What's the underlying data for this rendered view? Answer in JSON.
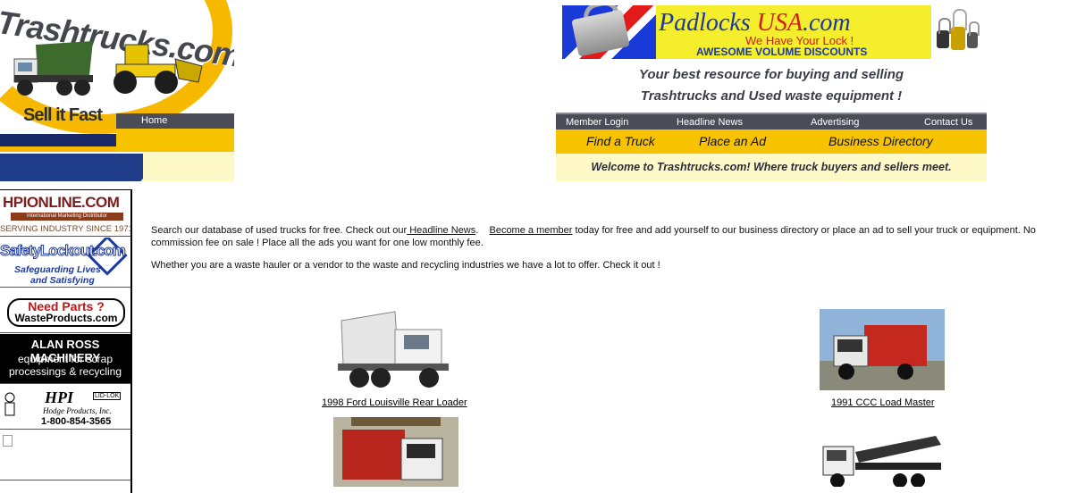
{
  "logo": {
    "title": "Trashtrucks.com",
    "slogan": "Sell it Fast",
    "home_label": "Home"
  },
  "banner": {
    "brand_main": "Padlocks ",
    "brand_accent": "USA",
    "brand_tail": ".com",
    "tagline": "We Have Your Lock !",
    "discount": "AWESOME VOLUME DISCOUNTS"
  },
  "header": {
    "tagline1": "Your best resource for buying and selling",
    "tagline2": "Trashtrucks and Used waste equipment !"
  },
  "nav": {
    "top": [
      "Member Login",
      "Headline News",
      "Advertising",
      "Contact Us"
    ],
    "main": [
      "Find a Truck",
      "Place an Ad",
      "Business Directory"
    ],
    "welcome": "Welcome to Trashtrucks.com! Where truck buyers and sellers meet."
  },
  "sidebar": {
    "ad1": {
      "title": "HPIONLINE.COM",
      "bar": "International Marketing Distributor",
      "sub": "SERVING INDUSTRY SINCE 1971"
    },
    "ad2": {
      "title": "SafetyLockout.com",
      "line1": "Safeguarding Lives",
      "line2": "and Satisfying Regulations"
    },
    "ad3": {
      "line1": "Need Parts ?",
      "line2": "WasteProducts.com"
    },
    "ad4": {
      "line1": "ALAN ROSS MACHINERY",
      "line2": "equipment for scrap",
      "line3": "processings & recycling"
    },
    "ad5": {
      "logo": "HPI",
      "badge": "LID-LOK",
      "company": "Hodge Products, Inc.",
      "phone": "1-800-854-3565"
    }
  },
  "main": {
    "p1_a": "Search our database of used trucks for free. Check out our",
    "p1_link1": " Headline News",
    "p1_b": ".    ",
    "p1_link2": "Become a member",
    "p1_c": " today for free and add yourself to our business directory or place an ad to sell your truck or equipment. No commission fee on sale ! Place all the ads you want for one low monthly fee.",
    "p2": "Whether you are a waste hauler or a vendor to the waste and recycling industries we have a lot to offer. Check it out !"
  },
  "listings": [
    {
      "caption": "1998 Ford Louisville Rear Loader"
    },
    {
      "caption": "1991 CCC Load Master"
    }
  ],
  "colors": {
    "dark_nav": "#4a4d57",
    "yellow": "#f7c200",
    "cream": "#fff9c8",
    "navy": "#1f3c88"
  }
}
